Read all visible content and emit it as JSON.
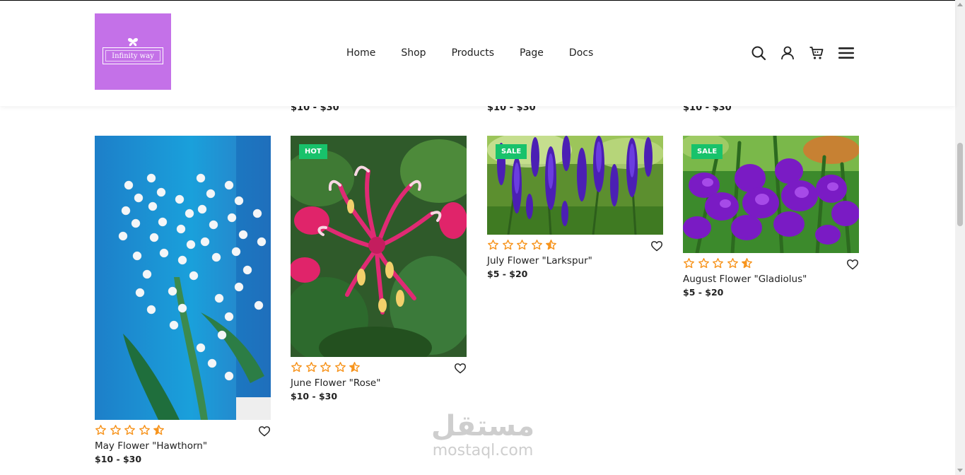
{
  "brand": {
    "logo_text": "Infinity way"
  },
  "nav": {
    "items": [
      "Home",
      "Shop",
      "Products",
      "Page",
      "Docs"
    ]
  },
  "header_icons": [
    "search-icon",
    "user-icon",
    "cart-icon",
    "menu-icon"
  ],
  "peek_prices": [
    "$10 - $30",
    "$10 - $30",
    "$10 - $30"
  ],
  "products": [
    {
      "title": "May Flower \"Hawthorn\"",
      "price": "$10 - $30",
      "badge": "",
      "rating": 4.5
    },
    {
      "title": "June Flower \"Rose\"",
      "price": "$10 - $30",
      "badge": "HOT",
      "rating": 4.5
    },
    {
      "title": "July Flower \"Larkspur\"",
      "price": "$5 - $20",
      "badge": "SALE",
      "rating": 4.5
    },
    {
      "title": "August Flower \"Gladiolus\"",
      "price": "$5 - $20",
      "badge": "SALE",
      "rating": 4.5
    }
  ],
  "watermark": {
    "arabic": "مستقل",
    "latin": "mostaql.com"
  },
  "colors": {
    "brand": "#c471e8",
    "badge": "#18c26b",
    "star": "#f7941d"
  }
}
